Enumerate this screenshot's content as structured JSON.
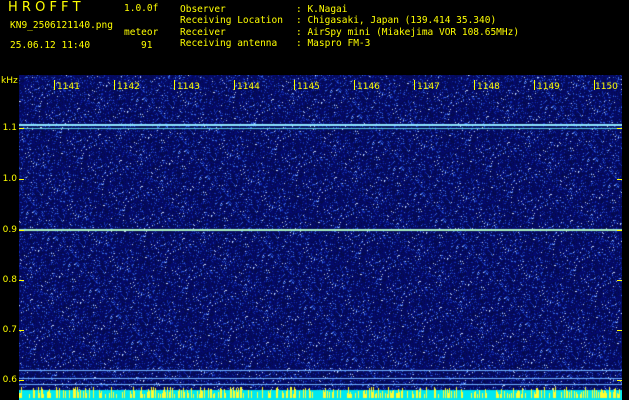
{
  "header": {
    "logo": "H R O F F T",
    "version": "1.0.0f",
    "filename": "KN9_2506121140.png",
    "meteor_label": "meteor",
    "timestamp": "25.06.12 11:40",
    "meteor_count": "91"
  },
  "info": {
    "observer_label": "Observer",
    "observer_value": ": K.Nagai",
    "location_label": "Receiving Location",
    "location_value": ": Chigasaki, Japan (139.414 35.340)",
    "receiver_label": "Receiver",
    "receiver_value": ": AirSpy mini (Miakejima VOR 108.65MHz)",
    "antenna_label": "Receiving antenna",
    "antenna_value": ": Maspro FM-3"
  },
  "axis": {
    "y_unit": "kHz",
    "y_ticks": [
      "1.1",
      "1.0",
      "0.9",
      "0.8",
      "0.7",
      "0.6"
    ],
    "x_ticks": [
      "1141",
      "1142",
      "1143",
      "1144",
      "1145",
      "1146",
      "1147",
      "1148",
      "1149",
      "1150"
    ]
  },
  "colors": {
    "background": "#000000",
    "label": "#ffff00",
    "noise_base": "#0a1a7a",
    "trace": "#7fe0ff",
    "bottom_bar": "#00ffff"
  }
}
